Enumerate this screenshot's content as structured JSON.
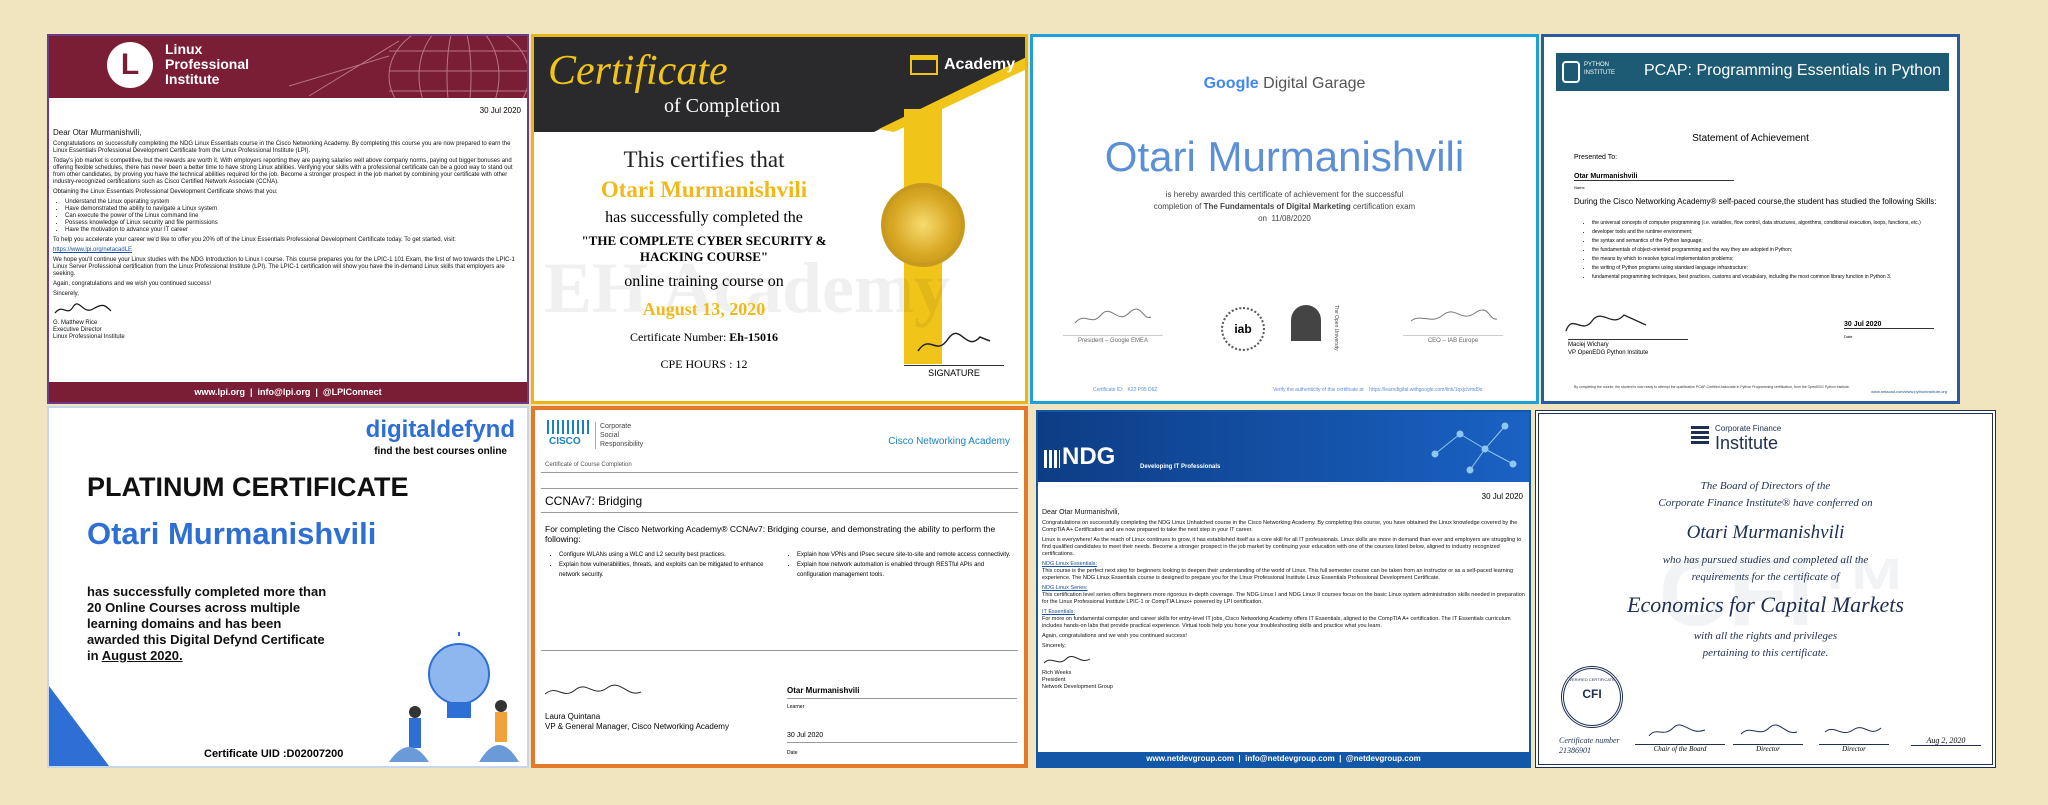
{
  "lpi": {
    "org_line1": "Linux",
    "org_line2": "Professional",
    "org_line3": "Institute",
    "date": "30 Jul 2020",
    "greeting": "Dear Otar Murmanishvili,",
    "para1": "Congratulations on successfully completing the NDG Linux Essentials course in the Cisco Networking Academy. By completing this course you are now prepared to earn the Linux Essentials Professional Development Certificate from the Linux Professional Institute (LPI).",
    "para2": "Today's job market is competitive, but the rewards are worth it. With employers reporting they are paying salaries well above company norms, paying out bigger bonuses and offering flexible schedules, there has never been a better time to have strong Linux abilities. Verifying your skills with a professional certificate can be a good way to stand out from other candidates, by proving you have the technical abilities required for the job. Become a stronger prospect in the job market by combining your certificate with other industry-recognized certifications such as Cisco Certified Network Associate (CCNA).",
    "para3": "Obtaining the Linux Essentials Professional Development Certificate shows that you:",
    "bullets": [
      "Understand the Linux operating system",
      "Have demonstrated the ability to navigate a Linux system",
      "Can execute the power of the Linux command line",
      "Possess knowledge of Linux security and file permissions",
      "Have the motivation to advance your IT career"
    ],
    "para4": "To help you accelerate your career we'd like to offer you 20% off of the Linux Essentials Professional Development Certificate today. To get started, visit:",
    "link": "https://www.lpi.org/netacadLE",
    "para5": "We hope you'll continue your Linux studies with the NDG Introduction to Linux I course. This course prepares you for the LPIC-1 101 Exam, the first of two towards the LPIC-1 Linux Server Professional certification from the Linux Professional Institute (LPI). The LPIC-1 certification will show you have the in-demand Linux skills that employers are seeking.",
    "para6": "Again, congratulations and we wish you continued success!",
    "closing": "Sincerely,",
    "signer_name": "G. Matthew Rice",
    "signer_title": "Executive Director",
    "signer_org": "Linux Professional Institute",
    "footer": "www.lpi.org  |  info@lpi.org  |  @LPIConnect"
  },
  "eh": {
    "title_script": "Certificate",
    "title_sub": "of Completion",
    "brand": "Academy",
    "certifies": "This certifies that",
    "name": "Otari Murmanishvili",
    "completed": "has successfully completed the",
    "course_line1": "\"THE COMPLETE CYBER SECURITY &",
    "course_line2": "HACKING COURSE\"",
    "online": "online training course on",
    "date": "August 13, 2020",
    "cert_number_label": "Certificate Number:",
    "cert_number": "Eh-15016",
    "cpe": "CPE HOURS : 12",
    "signature_label": "SIGNATURE",
    "watermark": "EH Academy"
  },
  "google": {
    "brand_google": "Google",
    "brand_rest": " Digital Garage",
    "name": "Otari Murmanishvili",
    "line1": "is hereby awarded this certificate of achievement for the successful",
    "line2_pre": "completion of ",
    "line2_bold": "The Fundamentals of Digital Marketing",
    "line2_post": " certification exam",
    "date_pre": "on  ",
    "date": "11/08/2020",
    "sig1": "President – Google EMEA",
    "sig2": "CEO – IAB Europe",
    "iab": "iab",
    "ou": "The Open University",
    "cert_no": "Certificate ID:   K22 P95 D6Z",
    "verify": "Verify the authenticity of this certificate at    https://learndigital.withgoogle.com/link/1qxjclvmd9s"
  },
  "pcap": {
    "logo_top": "PYTHON",
    "logo_bottom": "INSTITUTE",
    "title": "PCAP: Programming Essentials in Python",
    "statement": "Statement of Achievement",
    "presented": "Presented To:",
    "name": "Otar Murmanishvili",
    "name_label": "Name",
    "intro": "During the Cisco Networking Academy® self-paced course,the student has studied the following Skills:",
    "skills": [
      "the universal concepts of computer programming (i.e. variables, flow control, data structures, algorithms, conditional execution, loops, functions, etc.)",
      "developer tools and the runtime environment;",
      "the syntax and semantics of the Python language;",
      "the fundamentals of object-oriented programming and the way they are adopted in Python;",
      "the means by which to resolve typical implementation problems;",
      "the writing of Python programs using standard language infrastructure;",
      "fundamental programming techniques, best practices, customs and vocabulary, including the most common library function in Python 3."
    ],
    "signer": "Maciej Wichary",
    "signer_title": "VP OpenEDG Python Institute",
    "date": "30 Jul 2020",
    "date_label": "Date",
    "footer": "By completing the course, the student is now ready to attempt the qualification PCAP-Certified Associate in Python Programming certification, from the OpenEDG Python Institute.",
    "footer_url": "www.netacad.com/www.pythoninstitute.org"
  },
  "digitaldefynd": {
    "brand": "digitaldefynd",
    "tagline": "find the best courses online",
    "title": "PLATINUM CERTIFICATE",
    "name": "Otari Murmanishvili",
    "line1": "has successfully completed more than",
    "line2": "20 Online Courses across multiple",
    "line3": "learning domains and has been",
    "line4": "awarded this Digital Defynd Certificate",
    "line5_pre": "in ",
    "line5_date": "August 2020.",
    "uid": "Certificate UID :D02007200"
  },
  "ccna": {
    "brand": "CISCO",
    "csr1": "Corporate",
    "csr2": "Social",
    "csr3": "Responsibility",
    "academy": "Cisco Networking Academy",
    "type": "Certificate of Course Completion",
    "course": "CCNAv7: Bridging",
    "intro": "For completing the Cisco Networking Academy® CCNAv7: Bridging course, and demonstrating the ability to perform the following:",
    "left_items": [
      "Configure WLANs using a WLC and L2 security best practices.",
      "Explain how vulnerabilities, threats, and exploits can be mitigated to enhance network security."
    ],
    "right_items": [
      "Explain how VPNs and IPsec secure site-to-site and remote access connectivity.",
      "Explain how network automation is enabled through RESTful APIs and configuration management tools."
    ],
    "signer": "Laura Quintana",
    "signer_title": "VP & General Manager, Cisco Networking Academy",
    "learner": "Otar Murmanishvili",
    "learner_label": "Learner",
    "date": "30 Jul 2020",
    "date_label": "Date"
  },
  "ndg": {
    "brand": "NDG",
    "tagline": "Developing IT Professionals",
    "date": "30 Jul 2020",
    "greeting": "Dear Otar Murmanishvili,",
    "para1": "Congratulations on successfully completing the NDG Linux Unhatched course in the Cisco Networking Academy. By completing this course, you have obtained the Linux knowledge covered by the CompTIA A+ Certification and are now prepared to take the next step in your IT career.",
    "para2": "Linux is everywhere! As the reach of Linux continues to grow, it has established itself as a core skill for all IT professionals. Linux skills are more in demand than ever and employers are struggling to find qualified candidates to meet their needs. Become a stronger prospect in the job market by continuing your education with one of the courses listed below, aligned to industry recognized certifications.",
    "h1": "NDG Linux Essentials:",
    "p1": "This course is the perfect next step for beginners looking to deepen their understanding of the world of Linux. This full semester course can be taken from an instructor or as a self-paced learning experience. The NDG Linux Essentials course is designed to prepare you for the Linux Professional Institute Linux Essentials Professional Development Certificate.",
    "h2": "NDG Linux Series:",
    "p2": "This certification level series offers beginners more rigorous in-depth coverage. The NDG Linux I and NDG Linux II courses focus on the basic Linux system administration skills needed in preparation for the Linux Professional Institute LPIC-1 or CompTIA Linux+ powered by LPI certification.",
    "h3": "IT Essentials:",
    "p3": "For more on fundamental computer and career skills for entry-level IT jobs, Cisco Networking Academy offers IT Essentials, aligned to the CompTIA A+ certification. The IT Essentials curriculum includes hands-on labs that provide practical experience. Virtual tools help you hone your troubleshooting skills and practice what you learn.",
    "para3": "Again, congratulations and we wish you continued success!",
    "closing": "Sincerely,",
    "signer": "Rich Weeks",
    "signer_title": "President",
    "signer_org": "Network Development Group",
    "footer": "www.netdevgroup.com  |  info@netdevgroup.com  |  @netdevgroup.com"
  },
  "cfi": {
    "brand_top": "Corporate Finance",
    "brand": "Institute",
    "line1": "The Board of Directors of the",
    "line2": "Corporate Finance Institute® have conferred on",
    "name": "Otari Murmanishvili",
    "line3": "who has pursued studies and completed all the",
    "line4": "requirements for the certificate of",
    "course": "Economics for Capital Markets",
    "line5": "with all the rights and privileges",
    "line6": "pertaining to this certificate.",
    "seal": "CFI",
    "seal_text": "VERIFIED CERTIFICATE",
    "cert_number_label": "Certificate number",
    "cert_number": "21386901",
    "sig1": "Chair of the Board",
    "sig2": "Director",
    "sig3": "Director",
    "date": "Aug 2, 2020",
    "watermark": "CFI™"
  },
  "colors": {
    "background": "#f1e5c0",
    "lpi_maroon": "#7a1e36",
    "eh_gold": "#f0c419",
    "google_blue": "#5b8fd6",
    "pcap_blue": "#1d5a73",
    "dd_blue": "#2e6fd6",
    "cisco_blue": "#1a80c2",
    "ndg_blue": "#1357a8",
    "cfi_navy": "#1d2f52"
  }
}
